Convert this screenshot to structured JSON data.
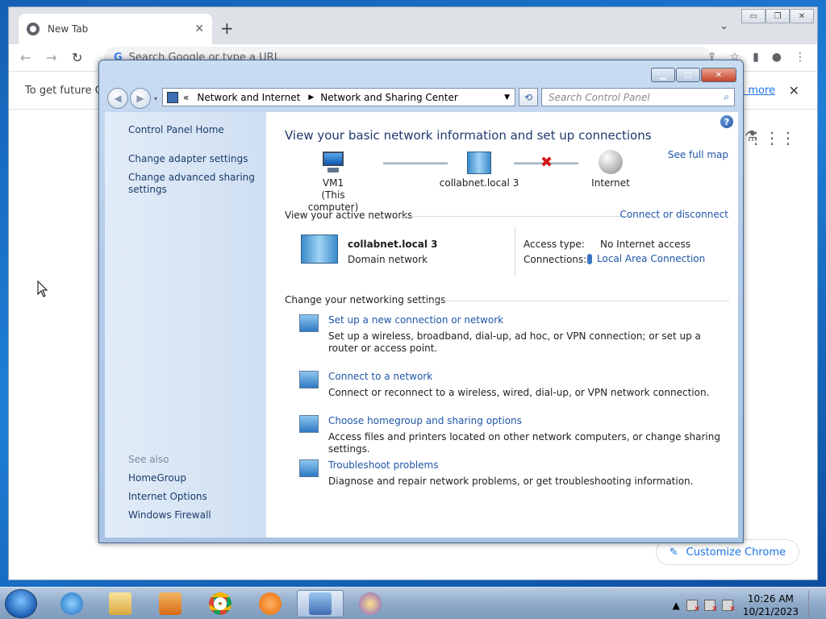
{
  "chrome": {
    "tab_title": "New Tab",
    "omnibox_placeholder": "Search Google or type a URL",
    "infobar_text": "To get future Go",
    "learn_more": "n more",
    "customize_label": "Customize Chrome"
  },
  "control_panel": {
    "breadcrumb": [
      "Network and Internet",
      "Network and Sharing Center"
    ],
    "search_placeholder": "Search Control Panel",
    "sidebar": {
      "home": "Control Panel Home",
      "links": [
        "Change adapter settings",
        "Change advanced sharing settings"
      ],
      "see_also_title": "See also",
      "see_also": [
        "HomeGroup",
        "Internet Options",
        "Windows Firewall"
      ]
    },
    "heading": "View your basic network information and set up connections",
    "see_full_map": "See full map",
    "map": {
      "computer_name": "VM1",
      "computer_sub": "(This computer)",
      "network_name": "collabnet.local  3",
      "internet": "Internet"
    },
    "active_networks": {
      "title": "View your active networks",
      "connect_link": "Connect or disconnect",
      "name": "collabnet.local  3",
      "type": "Domain network",
      "access_type_label": "Access type:",
      "access_type_value": "No Internet access",
      "connections_label": "Connections:",
      "connections_value": "Local Area Connection"
    },
    "settings": {
      "title": "Change your networking settings",
      "tasks": [
        {
          "link": "Set up a new connection or network",
          "desc": "Set up a wireless, broadband, dial-up, ad hoc, or VPN connection; or set up a router or access point."
        },
        {
          "link": "Connect to a network",
          "desc": "Connect or reconnect to a wireless, wired, dial-up, or VPN network connection."
        },
        {
          "link": "Choose homegroup and sharing options",
          "desc": "Access files and printers located on other network computers, or change sharing settings."
        },
        {
          "link": "Troubleshoot problems",
          "desc": "Diagnose and repair network problems, or get troubleshooting information."
        }
      ]
    }
  },
  "taskbar": {
    "time": "10:26 AM",
    "date": "10/21/2023"
  },
  "colors": {
    "link": "#1f55a8",
    "heading": "#1e3a6e",
    "error_x": "#d3151a"
  }
}
